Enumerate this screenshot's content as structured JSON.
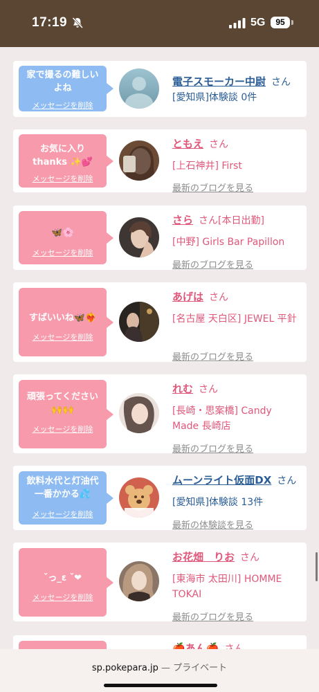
{
  "status_bar": {
    "time": "17:19",
    "network": "5G",
    "battery": "95",
    "icons": [
      "silent-mode-icon",
      "signal-bars-icon",
      "battery-icon"
    ]
  },
  "colors": {
    "header_brown": "#5a4633",
    "bubble_pink": "#f79aac",
    "bubble_blue": "#8ebcf2",
    "name_pink": "#e0577a",
    "name_blue": "#2a5d96",
    "link_gray": "#8c8c8c"
  },
  "delete_label": "メッセージを削除",
  "honorific": "さん",
  "entries": [
    {
      "bubble_color": "blue",
      "message": "家で撮るの難しいよね",
      "name": "電子スモーカー中尉",
      "name_suffix": "",
      "location": "[愛知県]体験談 0件",
      "link": "",
      "avatar_icon": "no-photo-avatar-icon"
    },
    {
      "bubble_color": "pink",
      "message": "お気に入り thanks ✨💕",
      "name": "ともえ",
      "name_suffix": "",
      "location": "[上石神井] First",
      "link": "最新のブログを見る",
      "avatar_icon": "woman-photo-avatar"
    },
    {
      "bubble_color": "pink",
      "message": "🦋🌸",
      "name": "さら",
      "name_suffix": "[本日出勤]",
      "location": "[中野] Girls Bar Papillon",
      "link": "最新のブログを見る",
      "avatar_icon": "woman-photo-avatar"
    },
    {
      "bubble_color": "pink",
      "message": "すばいいね🦋❤️‍🔥",
      "name": "あげは",
      "name_suffix": "",
      "location": "[名古屋 天白区] JEWEL 平針",
      "link": "最新のブログを見る",
      "avatar_icon": "woman-photo-avatar"
    },
    {
      "bubble_color": "pink",
      "message": "頑張ってください🙌🙌",
      "name": "れむ",
      "name_suffix": "",
      "location": "[長崎・思案橋] Candy Made 長崎店",
      "link": "最新のブログを見る",
      "avatar_icon": "woman-photo-avatar"
    },
    {
      "bubble_color": "blue",
      "message": "飲料水代と灯油代一番かかる💦",
      "name": "ムーンライト仮面DX",
      "name_suffix": "",
      "location": "[愛知県]体験談 13件",
      "link": "最新の体験談を見る",
      "avatar_icon": "koala-cookie-avatar"
    },
    {
      "bubble_color": "pink",
      "message": "ˇっ_ε ˇ❤",
      "name": "お花畑　りお",
      "name_suffix": "",
      "location": "[東海市 太田川] HOMME TOKAI",
      "link": "最新のブログを見る",
      "avatar_icon": "woman-photo-avatar"
    },
    {
      "bubble_color": "pink",
      "message": "",
      "name": "🍎あん🍎",
      "name_suffix": "",
      "location": "",
      "link": "",
      "avatar_icon": ""
    }
  ],
  "browser": {
    "domain": "sp.pokepara.jp",
    "separator": "—",
    "mode": "プライベート"
  }
}
